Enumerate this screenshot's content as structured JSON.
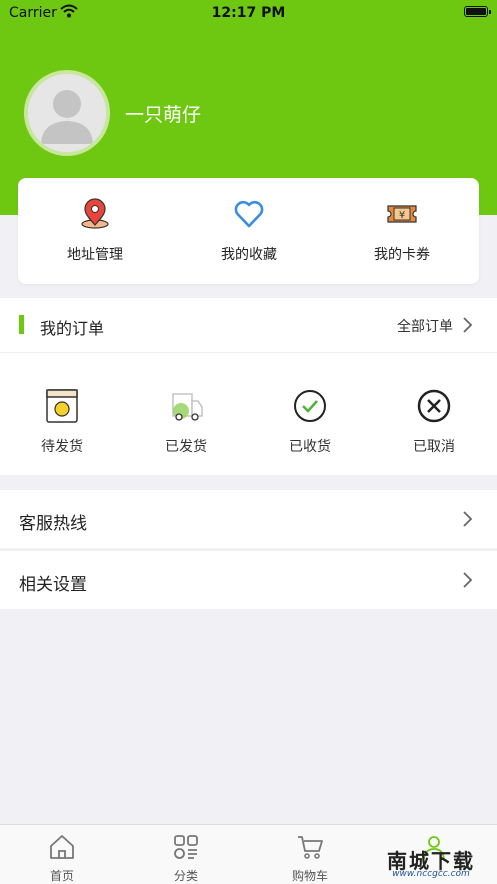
{
  "status_bar": {
    "carrier": "Carrier",
    "time": "12:17 PM"
  },
  "profile": {
    "username": "一只萌仔"
  },
  "quick_links": [
    {
      "label": "地址管理",
      "icon": "location-pin-icon"
    },
    {
      "label": "我的收藏",
      "icon": "heart-icon"
    },
    {
      "label": "我的卡券",
      "icon": "coupon-ticket-icon"
    }
  ],
  "orders": {
    "title": "我的订单",
    "all_label": "全部订单",
    "statuses": [
      {
        "label": "待发货",
        "icon": "pending-shipment-icon"
      },
      {
        "label": "已发货",
        "icon": "delivery-truck-icon"
      },
      {
        "label": "已收货",
        "icon": "check-circle-icon"
      },
      {
        "label": "已取消",
        "icon": "cancel-circle-icon"
      }
    ]
  },
  "menu": [
    {
      "label": "客服热线"
    },
    {
      "label": "相关设置"
    }
  ],
  "tabbar": [
    {
      "label": "首页",
      "icon": "home-icon"
    },
    {
      "label": "分类",
      "icon": "category-grid-icon"
    },
    {
      "label": "购物车",
      "icon": "shopping-cart-icon"
    },
    {
      "label": "",
      "icon": "user-icon",
      "active": true
    }
  ],
  "watermark": {
    "main": "南城下载",
    "sub": "www.nccgcc.com"
  },
  "colors": {
    "brand_green": "#6ec811",
    "page_bg": "#f1f1f5"
  }
}
